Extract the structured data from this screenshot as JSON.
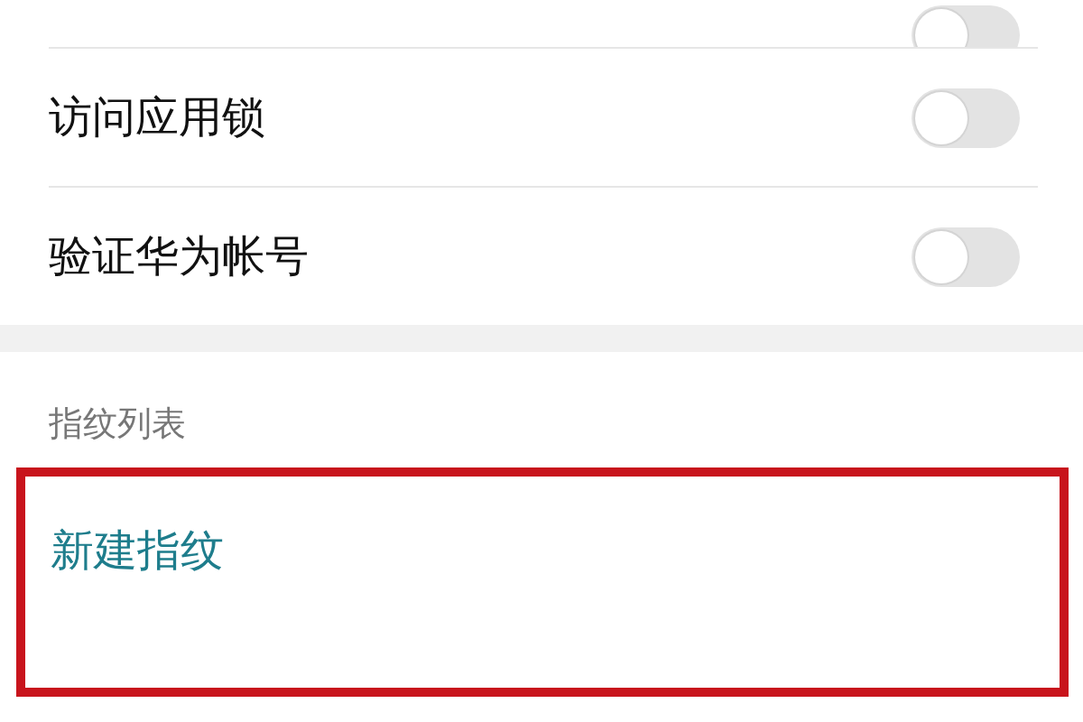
{
  "top_toggle": {
    "on": false
  },
  "toggles": [
    {
      "label": "访问应用锁",
      "on": false
    },
    {
      "label": "验证华为帐号",
      "on": false
    }
  ],
  "section": {
    "title": "指纹列表",
    "action": {
      "label": "新建指纹",
      "highlighted": true
    }
  }
}
